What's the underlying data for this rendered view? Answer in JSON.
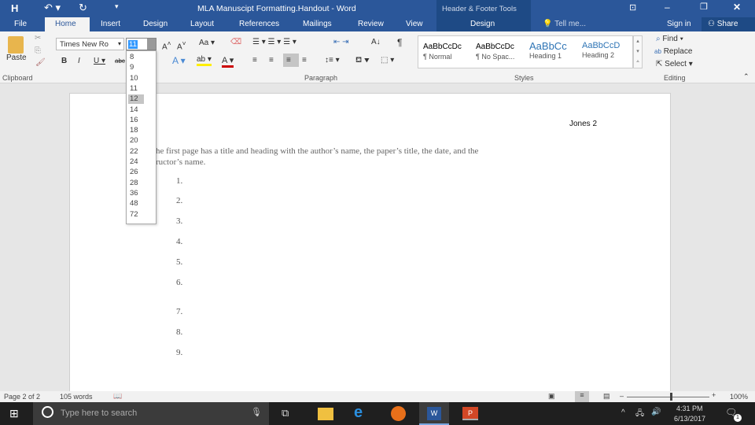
{
  "window": {
    "title": "MLA Manuscipt Formatting.Handout - Word",
    "context_tools": "Header & Footer Tools",
    "tell_me": "Tell me...",
    "sign_in": "Sign in",
    "share": "Share"
  },
  "tabs": [
    "File",
    "Home",
    "Insert",
    "Design",
    "Layout",
    "References",
    "Mailings",
    "Review",
    "View",
    "Design"
  ],
  "active_tab": "Home",
  "ribbon": {
    "paste": "Paste",
    "font_name": "Times New Ro",
    "font_size": "11",
    "groups": {
      "clipboard": "Clipboard",
      "paragraph": "Paragraph",
      "styles": "Styles",
      "editing": "Editing"
    },
    "styles": [
      {
        "preview": "AaBbCcDc",
        "name": "¶ Normal"
      },
      {
        "preview": "AaBbCcDc",
        "name": "¶ No Spac..."
      },
      {
        "preview": "AaBbCc",
        "name": "Heading 1"
      },
      {
        "preview": "AaBbCcD",
        "name": "Heading 2"
      }
    ],
    "find": "Find",
    "replace": "Replace",
    "select": "Select"
  },
  "font_size_options": [
    "8",
    "9",
    "10",
    "11",
    "12",
    "14",
    "16",
    "18",
    "20",
    "22",
    "24",
    "26",
    "28",
    "36",
    "48",
    "72"
  ],
  "font_size_highlighted": "12",
  "document": {
    "header": "Jones 2",
    "para_line1": "he first page has a title and heading with the author’s name, the paper’s title, the date, and the",
    "para_line2": "ructor’s name.",
    "list": [
      "1.",
      "2.",
      "3.",
      "4.",
      "5.",
      "6.",
      "7.",
      "8.",
      "9."
    ]
  },
  "status": {
    "page": "Page 2 of 2",
    "words": "105 words",
    "zoom": "100%",
    "zoom_percent": 100
  },
  "taskbar": {
    "search": "Type here to search",
    "time": "4:31 PM",
    "date": "6/13/2017",
    "notifications": "1"
  },
  "colors": {
    "word_blue": "#2b579a",
    "taskbar": "#1f1f1f"
  }
}
